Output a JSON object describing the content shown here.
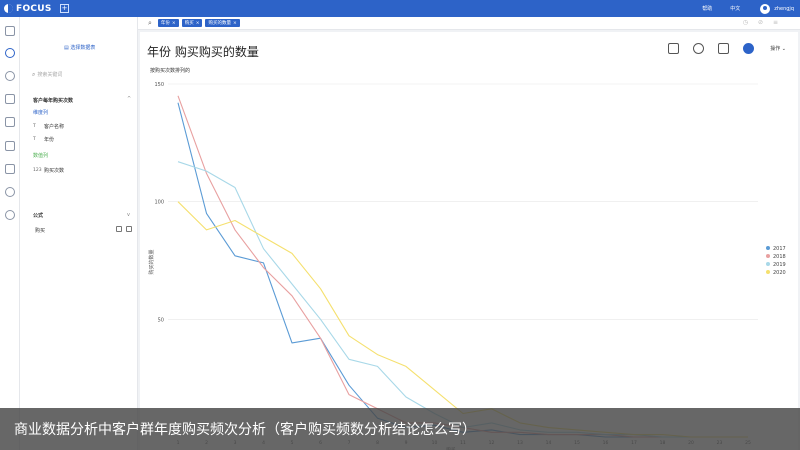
{
  "app": {
    "name": "FOCUS",
    "new_tab": "+"
  },
  "top_right": {
    "help": "帮助",
    "lang": "中文",
    "user": "zhengjq"
  },
  "left_panel": {
    "select_table": "选择数据表",
    "search_placeholder": "搜索关键词",
    "dataset_title": "客户每年购买次数",
    "dimension_label": "维度列",
    "measure_label": "数值列",
    "fields": [
      {
        "type": "T",
        "name": "客户名称"
      },
      {
        "type": "T",
        "name": "年份"
      },
      {
        "type": "123",
        "name": "购买次数"
      }
    ],
    "formula_title": "公式",
    "formula_item": "购买"
  },
  "query": {
    "chips": [
      "年份",
      "购买",
      "购买的数量"
    ]
  },
  "main": {
    "title": "年份 购买购买的数量",
    "subtitle": "按购买次数排列的",
    "action_label": "操作"
  },
  "colors": {
    "primary": "#2d63c8",
    "series_2017": "#5b9bd5",
    "series_2018": "#e8a0a0",
    "series_2019": "#a8d8e8",
    "series_2020": "#f5e06e"
  },
  "chart_data": {
    "type": "line",
    "title": "",
    "subtitle": "按购买次数排列的",
    "xlabel": "购买...",
    "ylabel": "购买的数量",
    "x": [
      "1",
      "2",
      "3",
      "4",
      "5",
      "6",
      "7",
      "8",
      "9",
      "10",
      "11",
      "12",
      "13",
      "14",
      "15",
      "16",
      "17",
      "18",
      "20",
      "23",
      "25"
    ],
    "ylim": [
      0,
      150
    ],
    "yticks": [
      50,
      100,
      150
    ],
    "series": [
      {
        "name": "2017",
        "color": "#5b9bd5",
        "values": [
          142,
          95,
          77,
          74,
          40,
          42,
          22,
          8,
          4,
          5,
          2,
          3,
          1,
          1,
          1,
          0,
          0,
          0,
          0,
          0,
          0
        ]
      },
      {
        "name": "2018",
        "color": "#e8a0a0",
        "values": [
          145,
          112,
          88,
          72,
          60,
          42,
          18,
          12,
          6,
          6,
          4,
          2,
          2,
          1,
          1,
          1,
          0,
          0,
          0,
          0,
          0
        ]
      },
      {
        "name": "2019",
        "color": "#a8d8e8",
        "values": [
          117,
          113,
          106,
          80,
          65,
          50,
          33,
          30,
          17,
          10,
          4,
          6,
          3,
          2,
          2,
          1,
          1,
          0,
          0,
          0,
          0
        ]
      },
      {
        "name": "2020",
        "color": "#f5e06e",
        "values": [
          100,
          88,
          92,
          85,
          78,
          63,
          43,
          35,
          30,
          20,
          10,
          12,
          6,
          4,
          3,
          2,
          1,
          1,
          0,
          0,
          0
        ]
      }
    ],
    "legend_position": "right",
    "grid": true
  },
  "caption": "商业数据分析中客户群年度购买频次分析（客户购买频数分析结论怎么写）"
}
